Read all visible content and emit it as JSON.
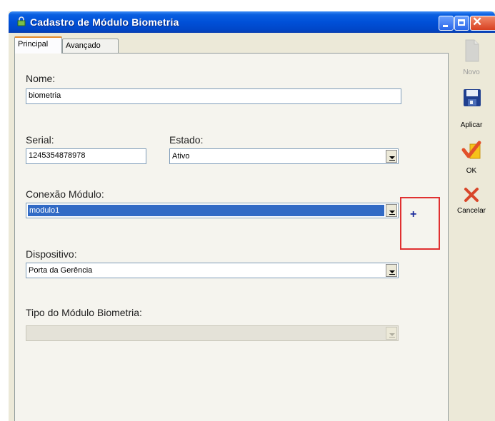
{
  "window": {
    "title": "Cadastro de Módulo Biometria"
  },
  "tabs": [
    {
      "label": "Principal"
    },
    {
      "label": "Avançado"
    }
  ],
  "form": {
    "nome_label": "Nome:",
    "nome_value": "biometria",
    "serial_label": "Serial:",
    "serial_value": "1245354878978",
    "estado_label": "Estado:",
    "estado_value": "Ativo",
    "conexao_label": "Conexão Módulo:",
    "conexao_value": "modulo1",
    "add_label": "+",
    "dispositivo_label": "Dispositivo:",
    "dispositivo_value": "Porta da Gerência",
    "tipo_label": "Tipo do Módulo Biometria:",
    "tipo_value": ""
  },
  "toolbar": {
    "novo": "Novo",
    "aplicar": "Aplicar",
    "ok": "OK",
    "cancelar": "Cancelar"
  },
  "icons": {
    "title": "lock-icon",
    "novo": "new-document-icon",
    "aplicar": "save-disk-icon",
    "ok": "checkmark-icon",
    "cancelar": "x-cancel-icon"
  },
  "colors": {
    "titlebar": "#0050d8",
    "selection": "#316ac5",
    "highlight_box": "#e03030",
    "add_button": "#1a2a9c"
  }
}
